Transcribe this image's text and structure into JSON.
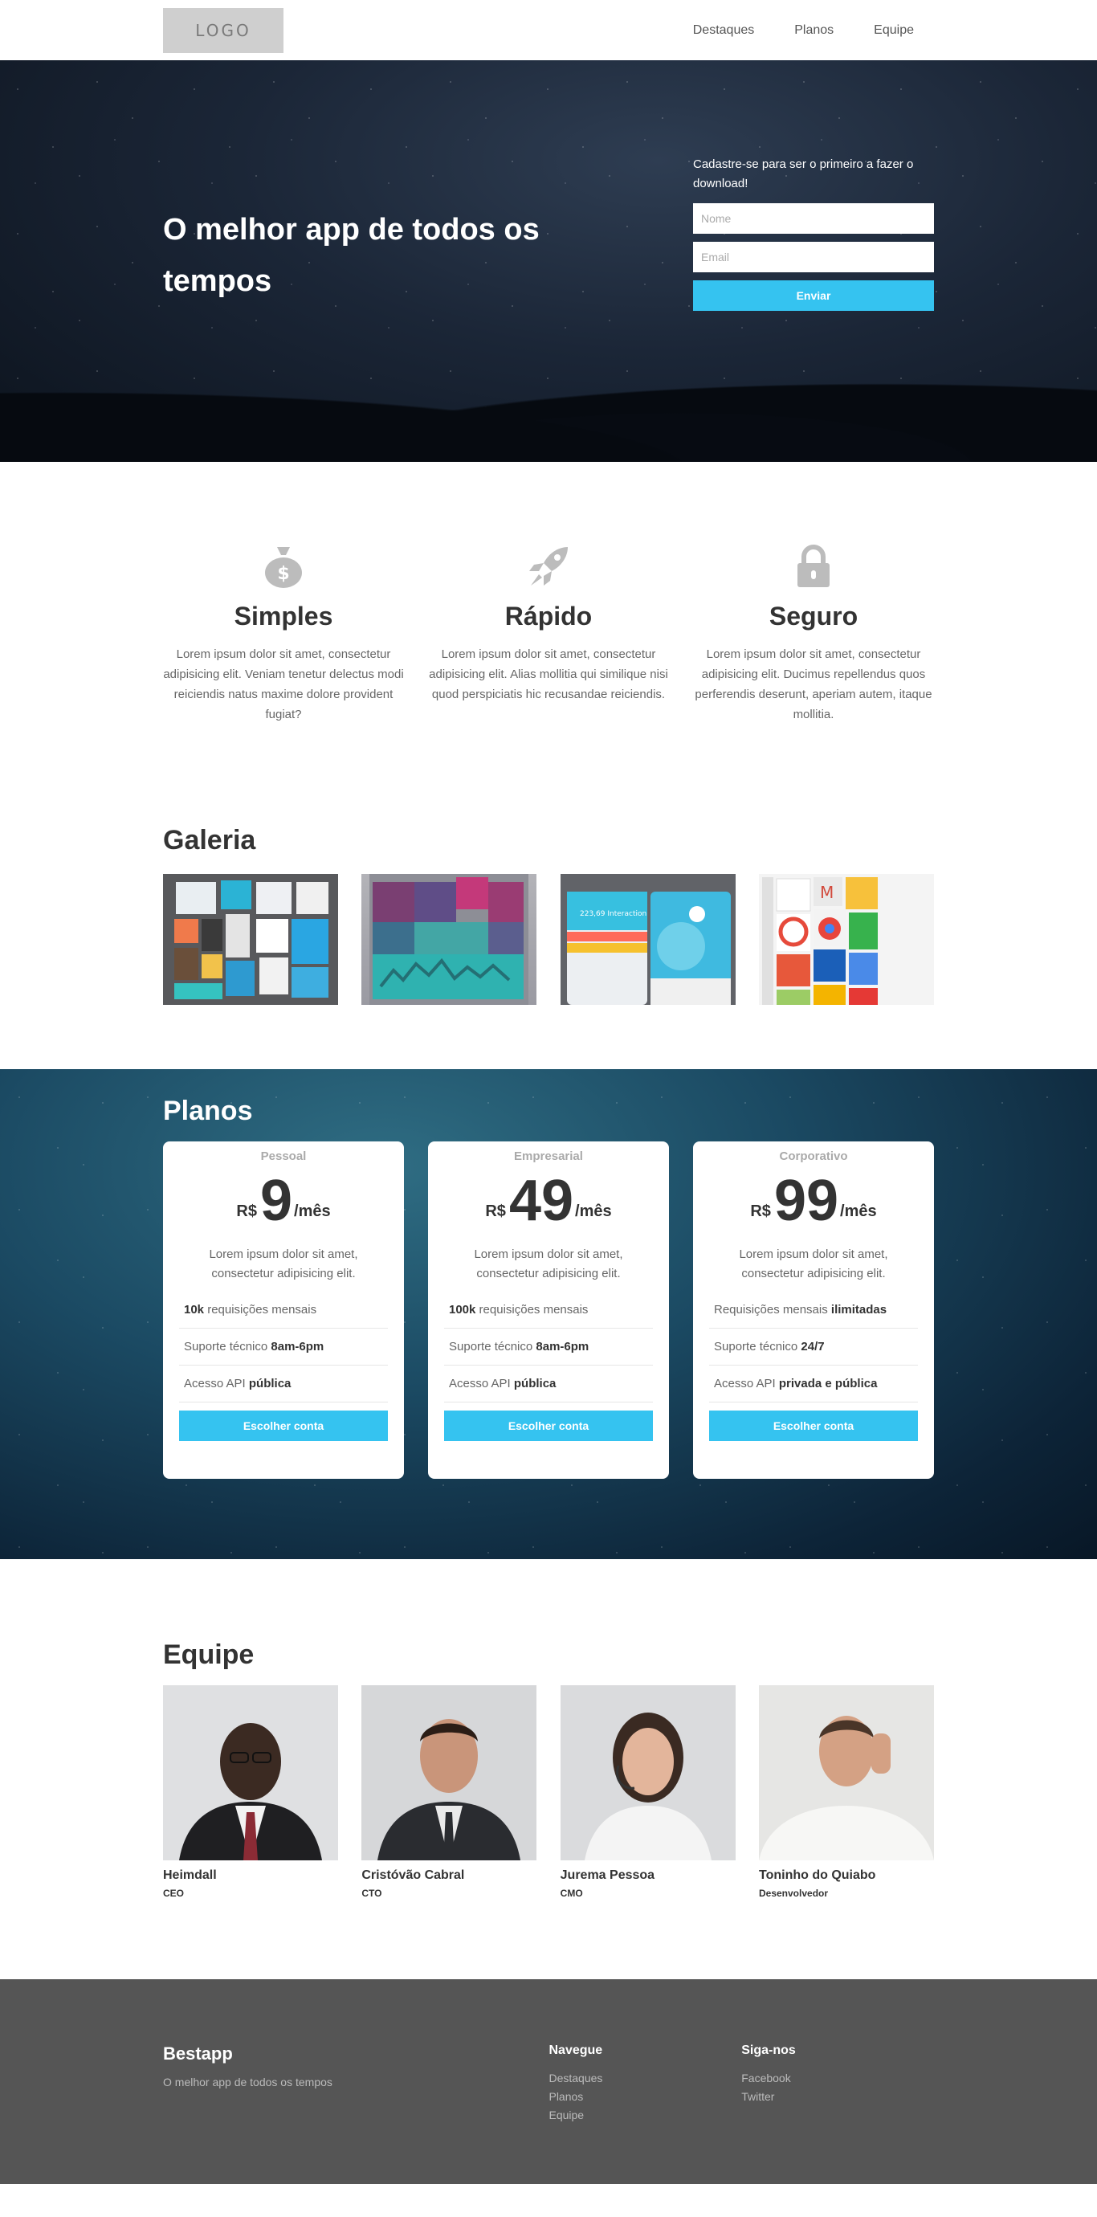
{
  "header": {
    "logo": "LOGO",
    "nav": [
      "Destaques",
      "Planos",
      "Equipe"
    ]
  },
  "hero": {
    "title": "O melhor app de todos os tempos",
    "signup_text": "Cadastre-se para ser o primeiro a fazer o download!",
    "name_placeholder": "Nome",
    "email_placeholder": "Email",
    "submit_label": "Enviar"
  },
  "features": [
    {
      "icon": "money-bag-icon",
      "title": "Simples",
      "text": "Lorem ipsum dolor sit amet, consectetur adipisicing elit. Veniam tenetur delectus modi reiciendis natus maxime dolore provident fugiat?"
    },
    {
      "icon": "rocket-icon",
      "title": "Rápido",
      "text": "Lorem ipsum dolor sit amet, consectetur adipisicing elit. Alias mollitia qui similique nisi quod perspiciatis hic recusandae reiciendis."
    },
    {
      "icon": "lock-icon",
      "title": "Seguro",
      "text": "Lorem ipsum dolor sit amet, consectetur adipisicing elit. Ducimus repellendus quos perferendis deserunt, aperiam autem, itaque mollitia."
    }
  ],
  "gallery": {
    "title": "Galeria",
    "t3_label": "223,69 Interaction"
  },
  "plans": {
    "title": "Planos",
    "items": [
      {
        "name": "Pessoal",
        "currency": "R$",
        "amount": "9",
        "period": "/mês",
        "desc": "Lorem ipsum dolor sit amet, consectetur adipisicing elit.",
        "features": [
          {
            "pre": "",
            "bold": "10k",
            "post": " requisições mensais"
          },
          {
            "pre": "Suporte técnico ",
            "bold": "8am-6pm",
            "post": ""
          },
          {
            "pre": "Acesso API ",
            "bold": "pública",
            "post": ""
          }
        ],
        "button": "Escolher conta"
      },
      {
        "name": "Empresarial",
        "currency": "R$",
        "amount": "49",
        "period": "/mês",
        "desc": "Lorem ipsum dolor sit amet, consectetur adipisicing elit.",
        "features": [
          {
            "pre": "",
            "bold": "100k",
            "post": " requisições mensais"
          },
          {
            "pre": "Suporte técnico ",
            "bold": "8am-6pm",
            "post": ""
          },
          {
            "pre": "Acesso API ",
            "bold": "pública",
            "post": ""
          }
        ],
        "button": "Escolher conta"
      },
      {
        "name": "Corporativo",
        "currency": "R$",
        "amount": "99",
        "period": "/mês",
        "desc": "Lorem ipsum dolor sit amet, consectetur adipisicing elit.",
        "features": [
          {
            "pre": "Requisições mensais ",
            "bold": "ilimitadas",
            "post": ""
          },
          {
            "pre": "Suporte técnico ",
            "bold": "24/7",
            "post": ""
          },
          {
            "pre": "Acesso API ",
            "bold": "privada e pública",
            "post": ""
          }
        ],
        "button": "Escolher conta"
      }
    ]
  },
  "team": {
    "title": "Equipe",
    "members": [
      {
        "name": "Heimdall",
        "role": "CEO"
      },
      {
        "name": "Cristóvão Cabral",
        "role": "CTO"
      },
      {
        "name": "Jurema Pessoa",
        "role": "CMO"
      },
      {
        "name": "Toninho do Quiabo",
        "role": "Desenvolvedor"
      }
    ]
  },
  "footer": {
    "brand": "Bestapp",
    "tagline": "O melhor app de todos os tempos",
    "nav_title": "Navegue",
    "nav_links": [
      "Destaques",
      "Planos",
      "Equipe"
    ],
    "social_title": "Siga-nos",
    "social_links": [
      "Facebook",
      "Twitter"
    ]
  },
  "colors": {
    "accent": "#35c3f0",
    "footer": "#555555"
  }
}
